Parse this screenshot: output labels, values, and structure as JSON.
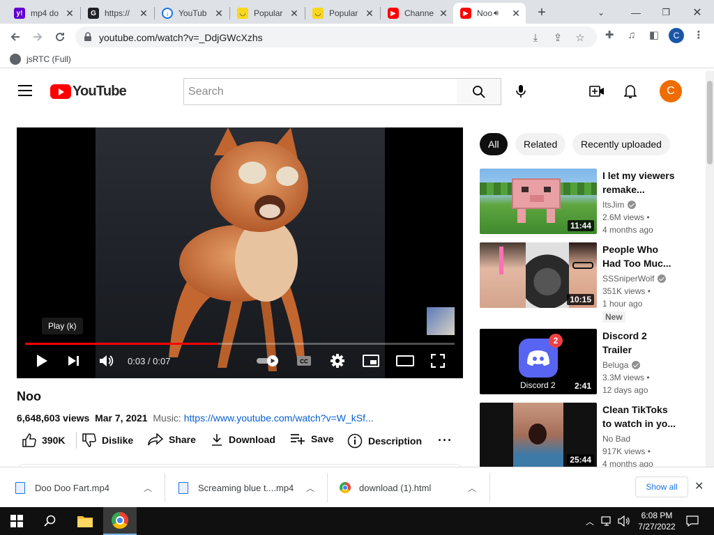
{
  "browser": {
    "tabs": [
      {
        "title": "mp4 do",
        "favicon": "yahoo-icon",
        "color": "#6001d2"
      },
      {
        "title": "https://",
        "favicon": "google-icon",
        "color": "#202124"
      },
      {
        "title": "YouTub",
        "favicon": "download-cloud-icon",
        "color": "#1a73e8"
      },
      {
        "title": "Popular",
        "favicon": "smiley-icon",
        "color": "#f9d71c"
      },
      {
        "title": "Popular",
        "favicon": "smiley-icon",
        "color": "#f9d71c"
      },
      {
        "title": "Channe",
        "favicon": "youtube-icon",
        "color": "#ff0000"
      },
      {
        "title": "Noo",
        "favicon": "youtube-icon",
        "color": "#ff0000",
        "active": true
      }
    ],
    "url": "youtube.com/watch?v=_DdjGWcXzhs",
    "profile_initial": "C",
    "bookmark": "jsRTC (Full)"
  },
  "youtube": {
    "logo_text": "YouTube",
    "search_placeholder": "Search",
    "avatar_initial": "C",
    "accent": "#ff0000"
  },
  "player": {
    "tooltip": "Play (k)",
    "time": "0:03 / 0:07",
    "played_fraction": 0.45,
    "loaded_fraction": 0.45
  },
  "video": {
    "title": "Noo",
    "views": "6,648,603 views",
    "date": "Mar 7, 2021",
    "music_label": "Music:",
    "music_link": "https://www.youtube.com/watch?v=W_kSf...",
    "actions": {
      "likes": "390K",
      "dislike": "Dislike",
      "share": "Share",
      "download": "Download",
      "save": "Save",
      "description": "Description"
    }
  },
  "sidebar": {
    "chips": [
      "All",
      "Related",
      "Recently uploaded"
    ],
    "recommendations": [
      {
        "title": "I let my viewers remake...",
        "channel": "ItsJim",
        "verified": true,
        "views": "2.6M views •",
        "age": "4 months ago",
        "duration": "11:44"
      },
      {
        "title": "People Who Had Too Muc...",
        "channel": "SSSniperWolf",
        "verified": true,
        "views": "351K views •",
        "age": "1 hour ago",
        "duration": "10:15",
        "badge": "New"
      },
      {
        "title": "Discord 2 Trailer",
        "channel": "Beluga",
        "verified": true,
        "views": "3.3M views •",
        "age": "12 days ago",
        "duration": "2:41",
        "thumb_text": "Discord 2",
        "thumb_badge": "2"
      },
      {
        "title": "Clean TikToks to watch in yo...",
        "channel": "No Bad",
        "verified": false,
        "views": "917K views •",
        "age": "4 months ago",
        "duration": "25:44"
      }
    ]
  },
  "downloads": {
    "items": [
      {
        "name": "Doo Doo Fart.mp4"
      },
      {
        "name": "Screaming blue t....mp4"
      },
      {
        "name": "download (1).html"
      }
    ],
    "show_all": "Show all"
  },
  "taskbar": {
    "time": "6:08 PM",
    "date": "7/27/2022"
  }
}
